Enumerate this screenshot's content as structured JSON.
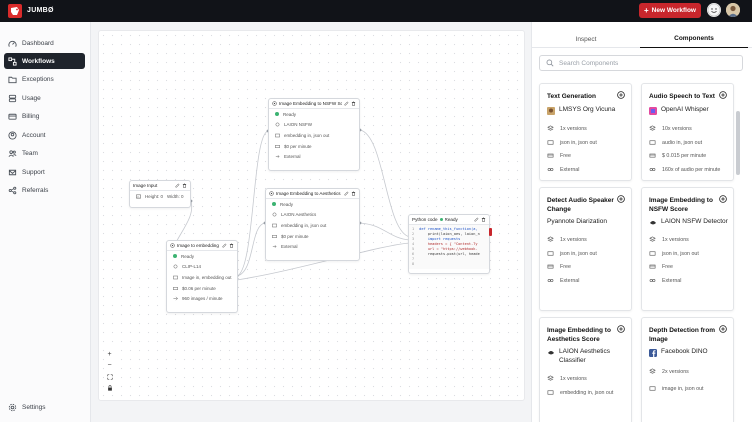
{
  "app": {
    "brand": "JUMBØ",
    "new_workflow_label": "New Workflow",
    "new_workflow_plus": "+"
  },
  "colors": {
    "brand_red": "#d92b2b",
    "topbar": "#111318",
    "active_nav": "#1f242c",
    "status_ready": "#3cb371"
  },
  "sidebar": {
    "items": [
      {
        "label": "Dashboard",
        "icon": "dashboard-icon"
      },
      {
        "label": "Workflows",
        "icon": "workflow-icon",
        "active": true
      },
      {
        "label": "Exceptions",
        "icon": "folder-icon"
      },
      {
        "label": "Usage",
        "icon": "database-icon"
      },
      {
        "label": "Billing",
        "icon": "billing-icon"
      },
      {
        "label": "Account",
        "icon": "account-icon"
      },
      {
        "label": "Team",
        "icon": "team-icon"
      },
      {
        "label": "Support",
        "icon": "support-icon"
      },
      {
        "label": "Referrals",
        "icon": "referrals-icon"
      }
    ],
    "settings_label": "Settings"
  },
  "canvas": {
    "zoom_controls": [
      "+",
      "−",
      "⛶",
      "🔒"
    ],
    "nodes": {
      "image_input": {
        "title": "Image Input",
        "height_label": "Height: 0",
        "width_label": "Width: 0"
      },
      "image_embedding": {
        "title": "Image to embedding",
        "status": "Ready",
        "model": "CLIP-L14",
        "io": "Image in, embedding out",
        "price": "$0.06 per minute",
        "throughput": "960 images / minute"
      },
      "nsfw": {
        "title": "Image Embedding to NSFW Score",
        "status": "Ready",
        "model": "LAION NSFW",
        "io": "embedding in, json out",
        "price": "$0 per minute",
        "deploy": "External"
      },
      "aesthetics": {
        "title": "Image Embedding to Aesthetics Score",
        "status": "Ready",
        "model": "LAION Aesthetics",
        "io": "embedding in, json out",
        "price": "$0 per minute",
        "deploy": "External"
      },
      "python": {
        "title": "Python code",
        "status": "Ready",
        "line_numbers": [
          "1",
          "2",
          "3",
          "4",
          "5",
          "6",
          "7",
          "8"
        ],
        "code_lines": [
          "def rename_this_function(a,",
          "    print(laion_aes, laion_n",
          "    import requests",
          "    headers = { \"Content-Ty",
          "    url = \"https://webhook.",
          "    requests.post(url, heade",
          "",
          ""
        ]
      }
    }
  },
  "panel": {
    "tabs": [
      "Inspect",
      "Components"
    ],
    "active_tab": "Components",
    "search_placeholder": "Search Components",
    "cards": [
      {
        "title": "Text Generation",
        "provider": "LMSYS Org Vicuna",
        "meta": [
          "1x versions",
          "json in, json out",
          "Free",
          "External"
        ]
      },
      {
        "title": "Audio Speech to Text",
        "provider": "OpenAI Whisper",
        "meta": [
          "10x versions",
          "audio in, json out",
          "$ 0.015 per minute",
          "160x of audio per minute"
        ]
      },
      {
        "title": "Detect Audio Speaker Change",
        "provider": "Pyannote Diarization",
        "meta": [
          "1x versions",
          "json in, json out",
          "Free",
          "External"
        ]
      },
      {
        "title": "Image Embedding to NSFW Score",
        "provider": "LAION NSFW Detector",
        "meta": [
          "1x versions",
          "json in, json out",
          "Free",
          "External"
        ]
      },
      {
        "title": "Image Embedding to Aesthetics Score",
        "provider": "LAION Aesthetics Classifier",
        "meta": [
          "1x versions",
          "embedding in, json out"
        ]
      },
      {
        "title": "Depth Detection from Image",
        "provider": "Facebook DINO",
        "meta": [
          "2x versions",
          "image in, json out"
        ]
      }
    ]
  }
}
